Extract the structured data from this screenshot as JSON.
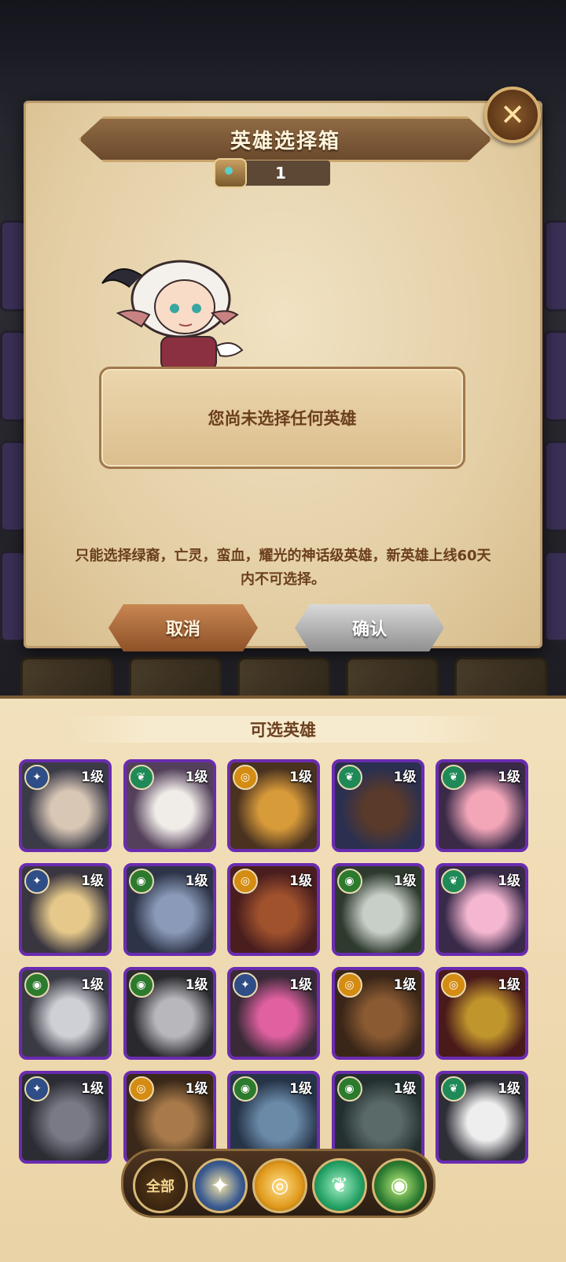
{
  "dialog": {
    "title": "英雄选择箱",
    "chest_count": "1",
    "message": "您尚未选择任何英雄",
    "rule": "只能选择绿裔，亡灵，蛮血，耀光的神话级英雄，新英雄上线60天内不可选择。",
    "cancel_label": "取消",
    "confirm_label": "确认"
  },
  "panel": {
    "title": "可选英雄"
  },
  "heroes": [
    {
      "level": "1级",
      "faction": "lightbearer"
    },
    {
      "level": "1级",
      "faction": "wilder"
    },
    {
      "level": "1级",
      "faction": "mauler"
    },
    {
      "level": "1级",
      "faction": "wilder"
    },
    {
      "level": "1级",
      "faction": "wilder"
    },
    {
      "level": "1级",
      "faction": "lightbearer"
    },
    {
      "level": "1级",
      "faction": "graveborn"
    },
    {
      "level": "1级",
      "faction": "mauler"
    },
    {
      "level": "1级",
      "faction": "graveborn"
    },
    {
      "level": "1级",
      "faction": "wilder"
    },
    {
      "level": "1级",
      "faction": "graveborn"
    },
    {
      "level": "1级",
      "faction": "graveborn"
    },
    {
      "level": "1级",
      "faction": "lightbearer"
    },
    {
      "level": "1级",
      "faction": "mauler"
    },
    {
      "level": "1级",
      "faction": "mauler"
    },
    {
      "level": "1级",
      "faction": "lightbearer"
    },
    {
      "level": "1级",
      "faction": "mauler"
    },
    {
      "level": "1级",
      "faction": "graveborn"
    },
    {
      "level": "1级",
      "faction": "graveborn"
    },
    {
      "level": "1级",
      "faction": "wilder"
    }
  ],
  "filters": {
    "all_label": "全部"
  },
  "colors": {
    "lightbearer": "#2f4d86",
    "wilder": "#1f8a58",
    "mauler": "#d58c12",
    "graveborn": "#2c7a2e",
    "frame": "#6a2bb0"
  }
}
